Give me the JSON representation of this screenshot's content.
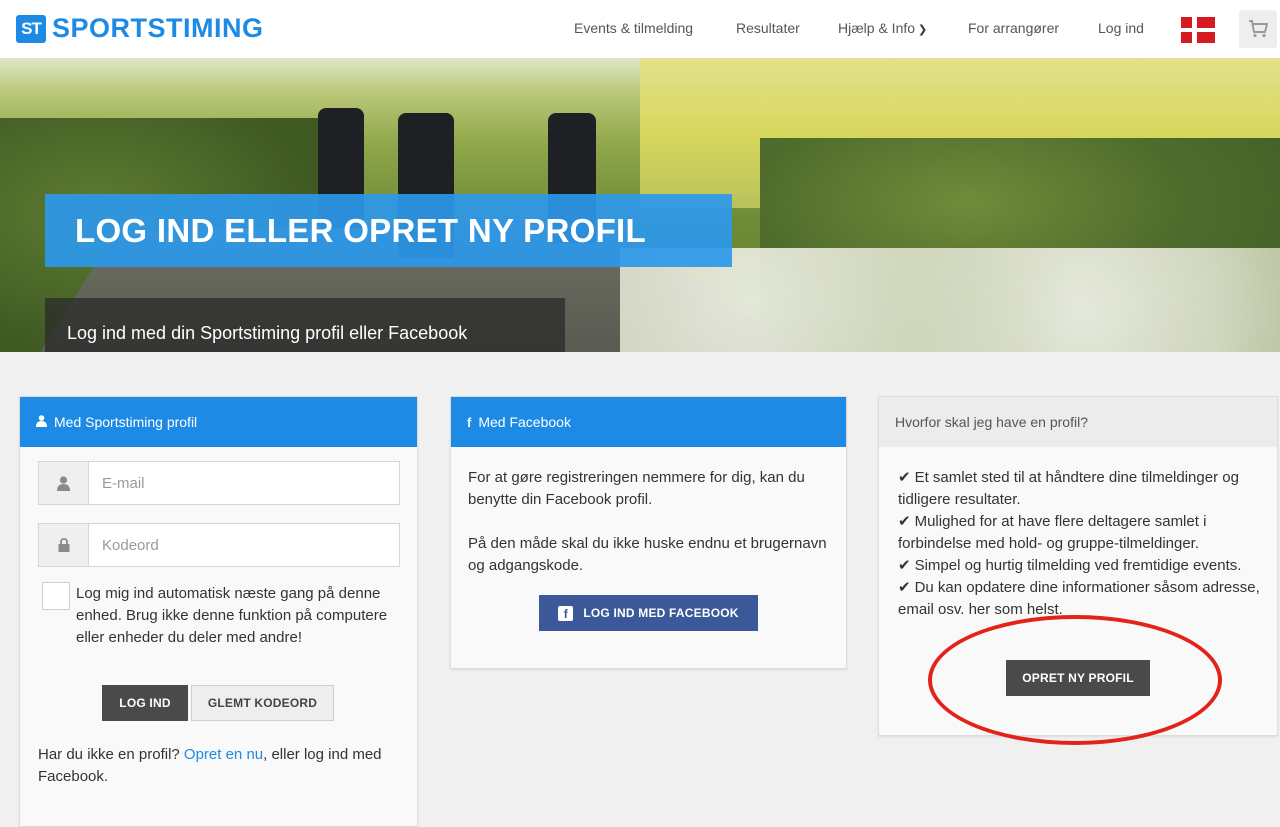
{
  "header": {
    "logo_badge": "ST",
    "logo_text": "SPORTSTIMING",
    "nav": {
      "events": "Events & tilmelding",
      "results": "Resultater",
      "help": "Hjælp & Info",
      "organizers": "For arrangører",
      "login": "Log ind"
    },
    "flag_icon": "denmark-flag-icon",
    "cart_icon": "shopping-cart-icon"
  },
  "hero": {
    "title": "LOG IND ELLER OPRET NY PROFIL",
    "subtitle": "Log ind med din Sportstiming profil eller Facebook"
  },
  "login_panel": {
    "heading": "Med Sportstiming profil",
    "email_placeholder": "E-mail",
    "password_placeholder": "Kodeord",
    "remember_label": "Log mig ind automatisk næste gang på denne enhed. Brug ikke denne funktion på computere eller enheder du deler med andre!",
    "login_button": "LOG IND",
    "forgot_button": "GLEMT KODEORD",
    "no_profile_prefix": "Har du ikke en profil? ",
    "no_profile_link": "Opret en nu",
    "no_profile_suffix": ", eller log ind med Facebook."
  },
  "facebook_panel": {
    "heading": "Med Facebook",
    "text1": "For at gøre registreringen nemmere for dig, kan du benytte din Facebook profil.",
    "text2": "På den måde skal du ikke huske endnu et brugernavn og adgangskode.",
    "button": "LOG IND MED FACEBOOK"
  },
  "profile_panel": {
    "heading": "Hvorfor skal jeg have en profil?",
    "reasons": [
      "Et samlet sted til at håndtere dine tilmeldinger og tidligere resultater.",
      "Mulighed for at have flere deltagere samlet i forbindelse med hold- og gruppe-tilmeldinger.",
      "Simpel og hurtig tilmelding ved fremtidige events.",
      "Du kan opdatere dine informationer såsom adresse, email osv. her som helst."
    ],
    "button": "OPRET NY PROFIL"
  },
  "colors": {
    "brand_blue": "#1d8ae6",
    "facebook_blue": "#3b5998",
    "dark_button": "#4a4a4a",
    "highlight_circle": "#e2231a"
  }
}
